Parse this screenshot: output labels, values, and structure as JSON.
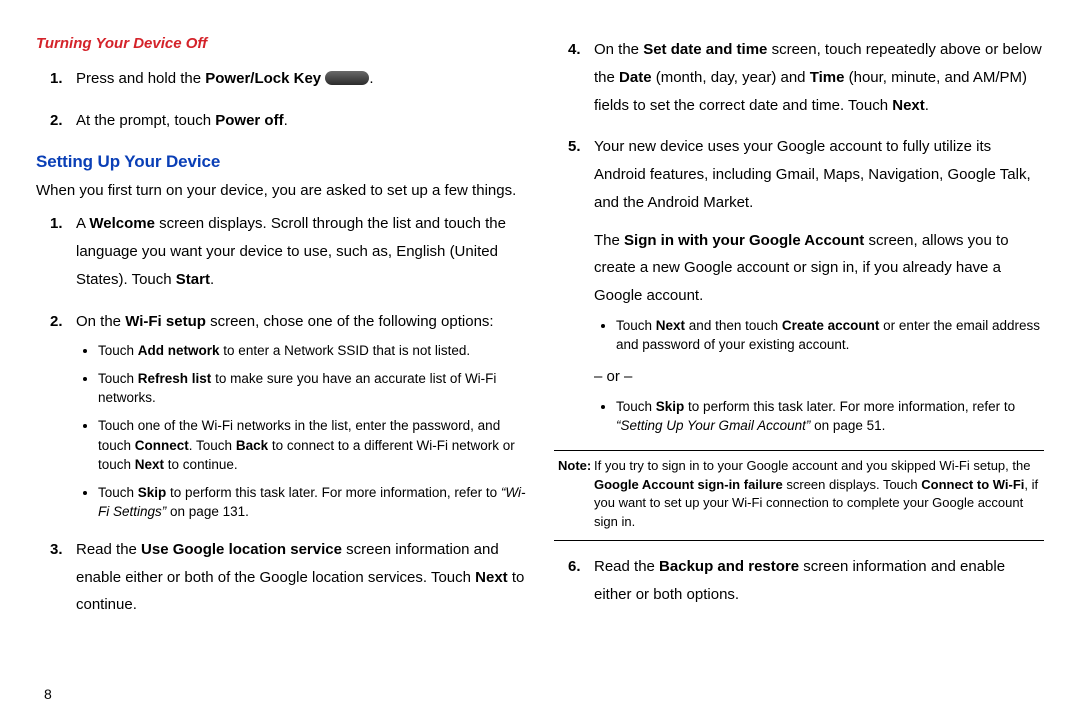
{
  "left": {
    "h_red": "Turning Your Device Off",
    "off_steps": [
      {
        "pre": "Press and hold the ",
        "b1": "Power/Lock Key",
        "post": " ",
        "trail": "."
      },
      {
        "pre": "At the prompt, touch ",
        "b1": "Power off",
        "post": "."
      }
    ],
    "h_blue": "Setting Up Your Device",
    "intro": "When you first turn on your device, you are asked to set up a few things.",
    "setup": {
      "s1": {
        "a": "A ",
        "b": "Welcome",
        "c": " screen displays. Scroll through the list and touch the language you want your device to use, such as, English (United States). Touch ",
        "d": "Start",
        "e": "."
      },
      "s2": {
        "a": "On the ",
        "b": "Wi-Fi setup",
        "c": " screen, chose one of the following options:"
      },
      "s2_bullets": {
        "b1": {
          "a": "Touch ",
          "b": "Add network",
          "c": " to enter a Network SSID that is not listed."
        },
        "b2": {
          "a": "Touch ",
          "b": "Refresh list",
          "c": " to make sure you have an accurate list of Wi-Fi networks."
        },
        "b3": {
          "a": "Touch one of the Wi-Fi networks in the list, enter the password, and touch ",
          "b": "Connect",
          "c": ". Touch ",
          "d": "Back",
          "e": " to connect to a different Wi-Fi network or touch ",
          "f": "Next",
          "g": " to continue."
        },
        "b4": {
          "a": "Touch ",
          "b": "Skip",
          "c": " to perform this task later. For more information, refer to ",
          "ref": "“Wi-Fi Settings”",
          "page": " on page 131."
        }
      },
      "s3": {
        "a": "Read the ",
        "b": "Use Google location service",
        "c": " screen information and enable either or both of the Google location services. Touch ",
        "d": "Next",
        "e": " to continue."
      }
    }
  },
  "right": {
    "s4": {
      "a": "On the ",
      "b": "Set date and time",
      "c": " screen, touch repeatedly above or below the ",
      "d": "Date",
      "e": " (month, day, year) and ",
      "f": "Time",
      "g": " (hour, minute, and AM/PM) fields to set the correct date and time. Touch ",
      "h": "Next",
      "i": "."
    },
    "s5": {
      "p1": "Your new device uses your Google account to fully utilize its Android features, including Gmail, Maps, Navigation, Google Talk, and the Android Market.",
      "p2a": "The ",
      "p2b": "Sign in with your Google Account",
      "p2c": " screen, allows you to create a new Google account or sign in, if you already have a Google account.",
      "b1": {
        "a": "Touch ",
        "b": "Next",
        "c": " and then touch ",
        "d": "Create account",
        "e": " or enter the email address and password of your existing account."
      },
      "or": "– or –",
      "b2": {
        "a": "Touch ",
        "b": "Skip",
        "c": " to perform this task later. For more information, refer to ",
        "ref": "“Setting Up Your Gmail Account”",
        "page": " on page 51."
      }
    },
    "note": {
      "label": "Note:",
      "a": " If you try to sign in to your Google account and you skipped Wi-Fi setup, the ",
      "b": "Google Account sign-in failure",
      "c": " screen displays. Touch ",
      "d": "Connect to Wi-Fi",
      "e": ", if you want to set up your Wi-Fi connection to complete your Google account sign in."
    },
    "s6": {
      "a": "Read the ",
      "b": "Backup and restore",
      "c": " screen information and enable either or both options."
    }
  },
  "page_number": "8"
}
